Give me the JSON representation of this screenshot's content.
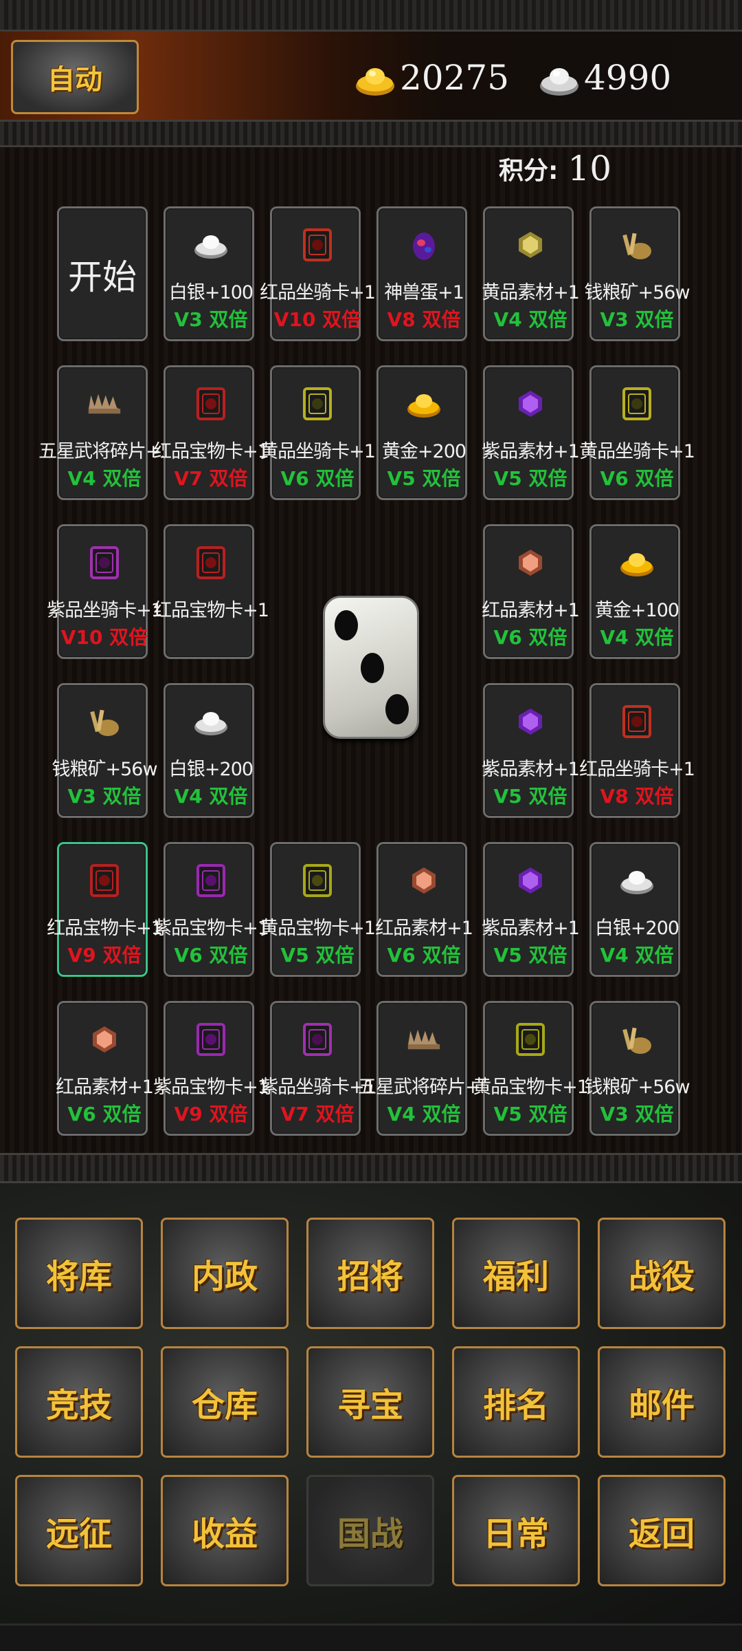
{
  "header": {
    "auto_label": "自动",
    "gold_value": "20275",
    "silver_value": "4990"
  },
  "score": {
    "label": "积分:",
    "value": "10"
  },
  "board": {
    "start_label": "开始",
    "cells": [
      {
        "name": "白银+100",
        "mult": "V3 双倍",
        "color": "green",
        "icon": "silver-ingot-icon"
      },
      {
        "name": "红品坐骑卡+1",
        "mult": "V10 双倍",
        "color": "red",
        "icon": "red-mount-card-icon"
      },
      {
        "name": "神兽蛋+1",
        "mult": "V8 双倍",
        "color": "red",
        "icon": "beast-egg-icon"
      },
      {
        "name": "黄品素材+1",
        "mult": "V4 双倍",
        "color": "green",
        "icon": "yellow-material-icon"
      },
      {
        "name": "钱粮矿+56w",
        "mult": "V3 双倍",
        "color": "green",
        "icon": "grain-ore-icon"
      },
      {
        "name": "五星武将碎片+50",
        "mult": "V4 双倍",
        "color": "green",
        "icon": "general-shard-icon"
      },
      {
        "name": "红品宝物卡+1",
        "mult": "V7 双倍",
        "color": "red",
        "icon": "red-treasure-card-icon"
      },
      {
        "name": "黄品坐骑卡+1",
        "mult": "V6 双倍",
        "color": "green",
        "icon": "yellow-mount-card-icon"
      },
      {
        "name": "黄金+200",
        "mult": "V5 双倍",
        "color": "green",
        "icon": "gold-ingot-icon"
      },
      {
        "name": "紫品素材+1",
        "mult": "V5 双倍",
        "color": "green",
        "icon": "purple-material-icon"
      },
      {
        "name": "黄品坐骑卡+1",
        "mult": "V6 双倍",
        "color": "green",
        "icon": "yellow-mount-card-icon"
      },
      {
        "name": "紫品坐骑卡+1",
        "mult": "V10 双倍",
        "color": "red",
        "icon": "purple-mount-card-icon"
      },
      {
        "name": "红品宝物卡+1",
        "mult": "",
        "color": "red",
        "icon": "red-treasure-card-icon"
      },
      {
        "name": "红品素材+1",
        "mult": "V6 双倍",
        "color": "green",
        "icon": "red-material-icon"
      },
      {
        "name": "黄金+100",
        "mult": "V4 双倍",
        "color": "green",
        "icon": "gold-ingot-icon"
      },
      {
        "name": "钱粮矿+56w",
        "mult": "V3 双倍",
        "color": "green",
        "icon": "grain-ore-icon"
      },
      {
        "name": "白银+200",
        "mult": "V4 双倍",
        "color": "green",
        "icon": "silver-ingot-icon"
      },
      {
        "name": "紫品素材+1",
        "mult": "V5 双倍",
        "color": "green",
        "icon": "purple-material-icon"
      },
      {
        "name": "红品坐骑卡+1",
        "mult": "V8 双倍",
        "color": "red",
        "icon": "red-mount-card-icon"
      },
      {
        "name": "红品宝物卡+1",
        "mult": "V9 双倍",
        "color": "red",
        "icon": "red-treasure-card-icon",
        "selected": true
      },
      {
        "name": "紫品宝物卡+1",
        "mult": "V6 双倍",
        "color": "green",
        "icon": "purple-treasure-card-icon"
      },
      {
        "name": "黄品宝物卡+1",
        "mult": "V5 双倍",
        "color": "green",
        "icon": "yellow-treasure-card-icon"
      },
      {
        "name": "红品素材+1",
        "mult": "V6 双倍",
        "color": "green",
        "icon": "red-material-icon"
      },
      {
        "name": "紫品素材+1",
        "mult": "V5 双倍",
        "color": "green",
        "icon": "purple-material-icon"
      },
      {
        "name": "白银+200",
        "mult": "V4 双倍",
        "color": "green",
        "icon": "silver-ingot-icon"
      },
      {
        "name": "红品素材+1",
        "mult": "V6 双倍",
        "color": "green",
        "icon": "red-material-icon"
      },
      {
        "name": "紫品宝物卡+1",
        "mult": "V9 双倍",
        "color": "red",
        "icon": "purple-treasure-card-icon"
      },
      {
        "name": "紫品坐骑卡+1",
        "mult": "V7 双倍",
        "color": "red",
        "icon": "purple-mount-card-icon"
      },
      {
        "name": "五星武将碎片+50",
        "mult": "V4 双倍",
        "color": "green",
        "icon": "general-shard-icon"
      },
      {
        "name": "黄品宝物卡+1",
        "mult": "V5 双倍",
        "color": "green",
        "icon": "yellow-treasure-card-icon"
      },
      {
        "name": "钱粮矿+56w",
        "mult": "V3 双倍",
        "color": "green",
        "icon": "grain-ore-icon"
      }
    ],
    "die_face": 3
  },
  "menu": [
    {
      "label": "将库"
    },
    {
      "label": "内政"
    },
    {
      "label": "招将"
    },
    {
      "label": "福利"
    },
    {
      "label": "战役"
    },
    {
      "label": "竞技"
    },
    {
      "label": "仓库"
    },
    {
      "label": "寻宝"
    },
    {
      "label": "排名"
    },
    {
      "label": "邮件"
    },
    {
      "label": "远征"
    },
    {
      "label": "收益"
    },
    {
      "label": "国战",
      "disabled": true
    },
    {
      "label": "日常"
    },
    {
      "label": "返回"
    }
  ],
  "colors": {
    "multiplier_green": "#22c23a",
    "multiplier_red": "#e0141e",
    "menu_text": "#f2c23a",
    "selected_border": "#3bc48a"
  }
}
